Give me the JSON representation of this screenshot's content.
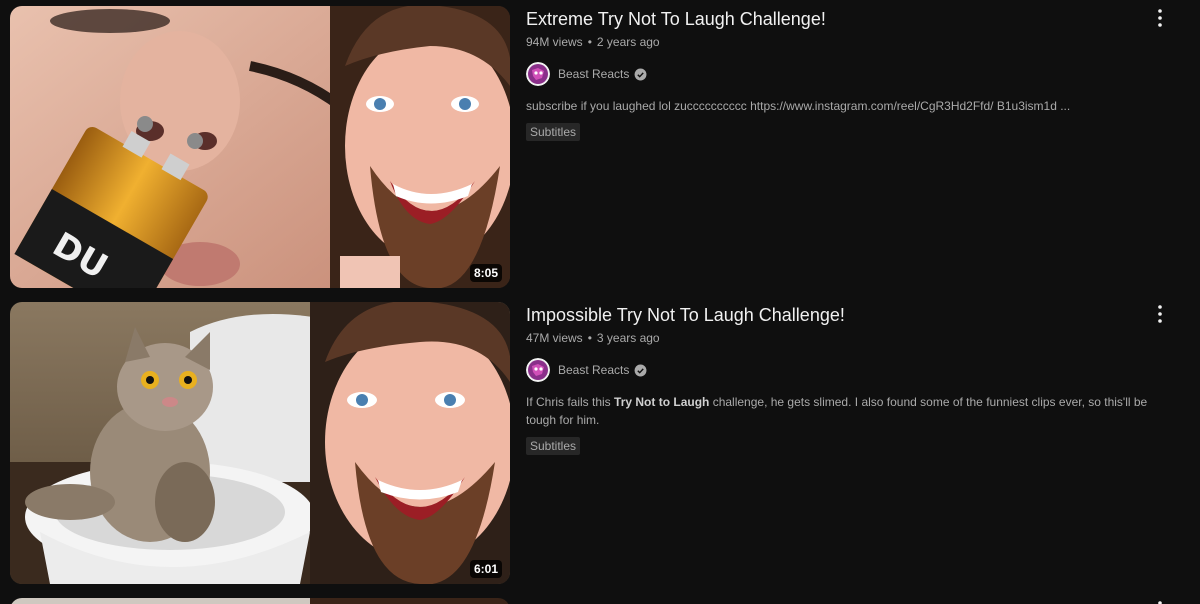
{
  "videos": [
    {
      "title": "Extreme Try Not To Laugh Challenge!",
      "views": "94M views",
      "age": "2 years ago",
      "channel": "Beast Reacts",
      "description": "subscribe if you laughed lol zucccccccccc https://www.instagram.com/reel/CgR3Hd2Ffd/ B1u3ism1d ...",
      "badge": "Subtitles",
      "duration": "8:05"
    },
    {
      "title": "Impossible Try Not To Laugh Challenge!",
      "views": "47M views",
      "age": "3 years ago",
      "channel": "Beast Reacts",
      "description_pre": "If Chris fails this ",
      "description_bold": "Try Not to Laugh",
      "description_post": " challenge, he gets slimed. I also found some of the funniest clips ever, so this'll be tough for him.",
      "badge": "Subtitles",
      "duration": "6:01"
    }
  ],
  "meta_separator": "•",
  "icons": {
    "more": "more-vert-icon",
    "verified": "verified-check-icon"
  },
  "colors": {
    "background": "#0f0f0f",
    "text_primary": "#f1f1f1",
    "text_secondary": "#aaaaaa",
    "badge_bg": "#272727"
  }
}
